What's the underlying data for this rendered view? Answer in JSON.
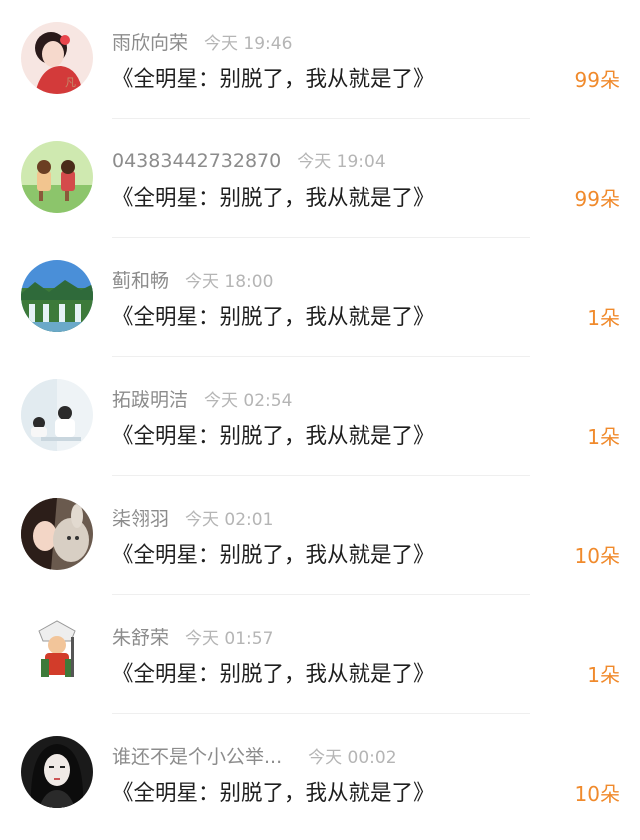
{
  "feed": [
    {
      "name": "雨欣向荣",
      "time": "今天 19:46",
      "message": "《全明星：别脱了，我从就是了》",
      "count": "99朵",
      "avatar_icon": "avatar-portrait-woman-red-icon"
    },
    {
      "name": "04383442732870",
      "time": "今天 19:04",
      "message": "《全明星：别脱了，我从就是了》",
      "count": "99朵",
      "avatar_icon": "avatar-cartoon-children-icon"
    },
    {
      "name": "蓟和畅",
      "time": "今天 18:00",
      "message": "《全明星：别脱了，我从就是了》",
      "count": "1朵",
      "avatar_icon": "avatar-waterfall-landscape-icon"
    },
    {
      "name": "拓跋明洁",
      "time": "今天 02:54",
      "message": "《全明星：别脱了，我从就是了》",
      "count": "1朵",
      "avatar_icon": "avatar-anime-couple-icon"
    },
    {
      "name": "柒翎羽",
      "time": "今天 02:01",
      "message": "《全明星：别脱了，我从就是了》",
      "count": "10朵",
      "avatar_icon": "avatar-girl-with-plush-icon"
    },
    {
      "name": "朱舒荣",
      "time": "今天 01:57",
      "message": "《全明星：别脱了，我从就是了》",
      "count": "1朵",
      "avatar_icon": "avatar-cartoon-warrior-icon"
    },
    {
      "name": "谁还不是个小公举...",
      "time": "今天 00:02",
      "message": "《全明星：别脱了，我从就是了》",
      "count": "10朵",
      "avatar_icon": "avatar-dark-hair-girl-icon"
    }
  ],
  "colors": {
    "count_accent": "#f08a2c",
    "name_text": "#8c8c8c",
    "time_text": "#b5b5b5",
    "message_text": "#1f1f1f"
  }
}
